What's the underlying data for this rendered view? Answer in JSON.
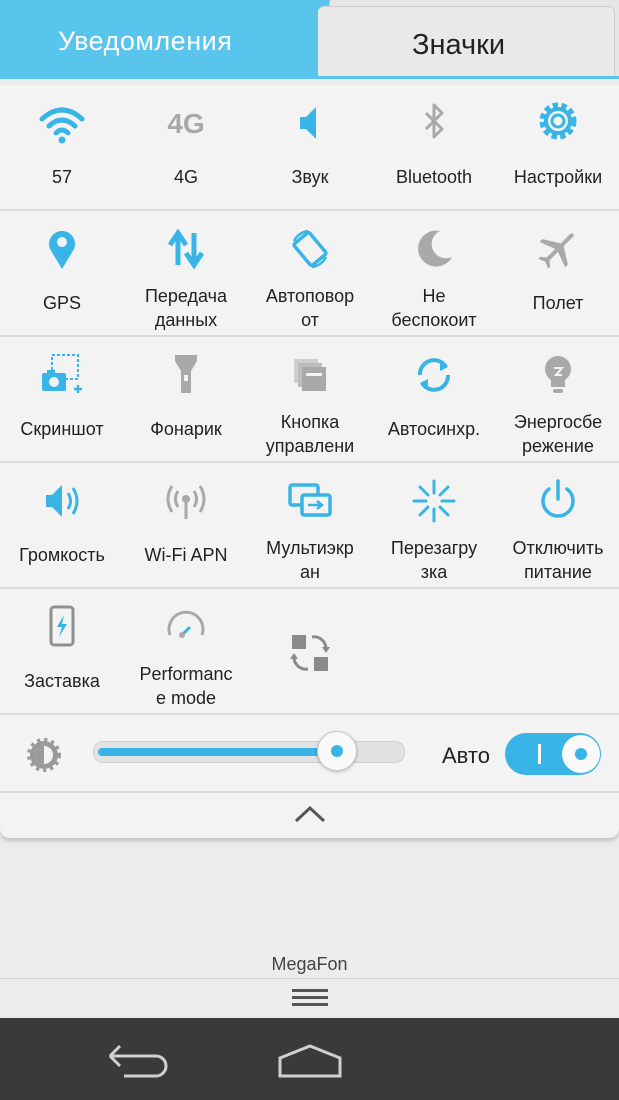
{
  "tabs": {
    "notifications": "Уведомления",
    "icons": "Значки"
  },
  "accent": "#39b4e6",
  "rows": [
    [
      {
        "label": "57",
        "icon": "wifi-icon"
      },
      {
        "label": "4G",
        "icon": "4g-icon"
      },
      {
        "label": "Звук",
        "icon": "sound-icon"
      },
      {
        "label": "Bluetooth",
        "icon": "bluetooth-icon"
      },
      {
        "label": "Настройки",
        "icon": "gear-icon"
      }
    ],
    [
      {
        "label1": "GPS",
        "icon": "location-pin-icon"
      },
      {
        "label1": "Передача",
        "label2": "данных",
        "icon": "data-transfer-icon"
      },
      {
        "label1": "Автоповор",
        "label2": "от",
        "icon": "auto-rotate-icon"
      },
      {
        "label1": "Не",
        "label2": "беспокоит",
        "icon": "moon-icon"
      },
      {
        "label1": "Полет",
        "icon": "airplane-icon"
      }
    ],
    [
      {
        "label1": "Скриншот",
        "icon": "screenshot-icon"
      },
      {
        "label1": "Фонарик",
        "icon": "flashlight-icon"
      },
      {
        "label1": "Кнопка",
        "label2": "управлени",
        "icon": "control-button-icon"
      },
      {
        "label1": "Автосинхр.",
        "icon": "sync-icon"
      },
      {
        "label1": "Энергосбе",
        "label2": "режение",
        "icon": "lightbulb-icon"
      }
    ],
    [
      {
        "label1": "Громкость",
        "icon": "volume-icon"
      },
      {
        "label1": "Wi-Fi APN",
        "icon": "wifi-apn-icon"
      },
      {
        "label1": "Мультиэкр",
        "label2": "ан",
        "icon": "multiscreen-icon"
      },
      {
        "label1": "Перезагру",
        "label2": "зка",
        "icon": "reboot-icon"
      },
      {
        "label1": "Отключить",
        "label2": "питание",
        "icon": "power-icon"
      }
    ],
    [
      {
        "label1": "Заставка",
        "icon": "screensaver-icon"
      },
      {
        "label1": "Performanc",
        "label2": "e mode",
        "icon": "performance-icon"
      },
      {
        "icon": "switch-arrange-icon"
      }
    ]
  ],
  "brightness": {
    "level": 0.82,
    "auto_label": "Авто",
    "auto_on": true
  },
  "operator": "MegaFon"
}
